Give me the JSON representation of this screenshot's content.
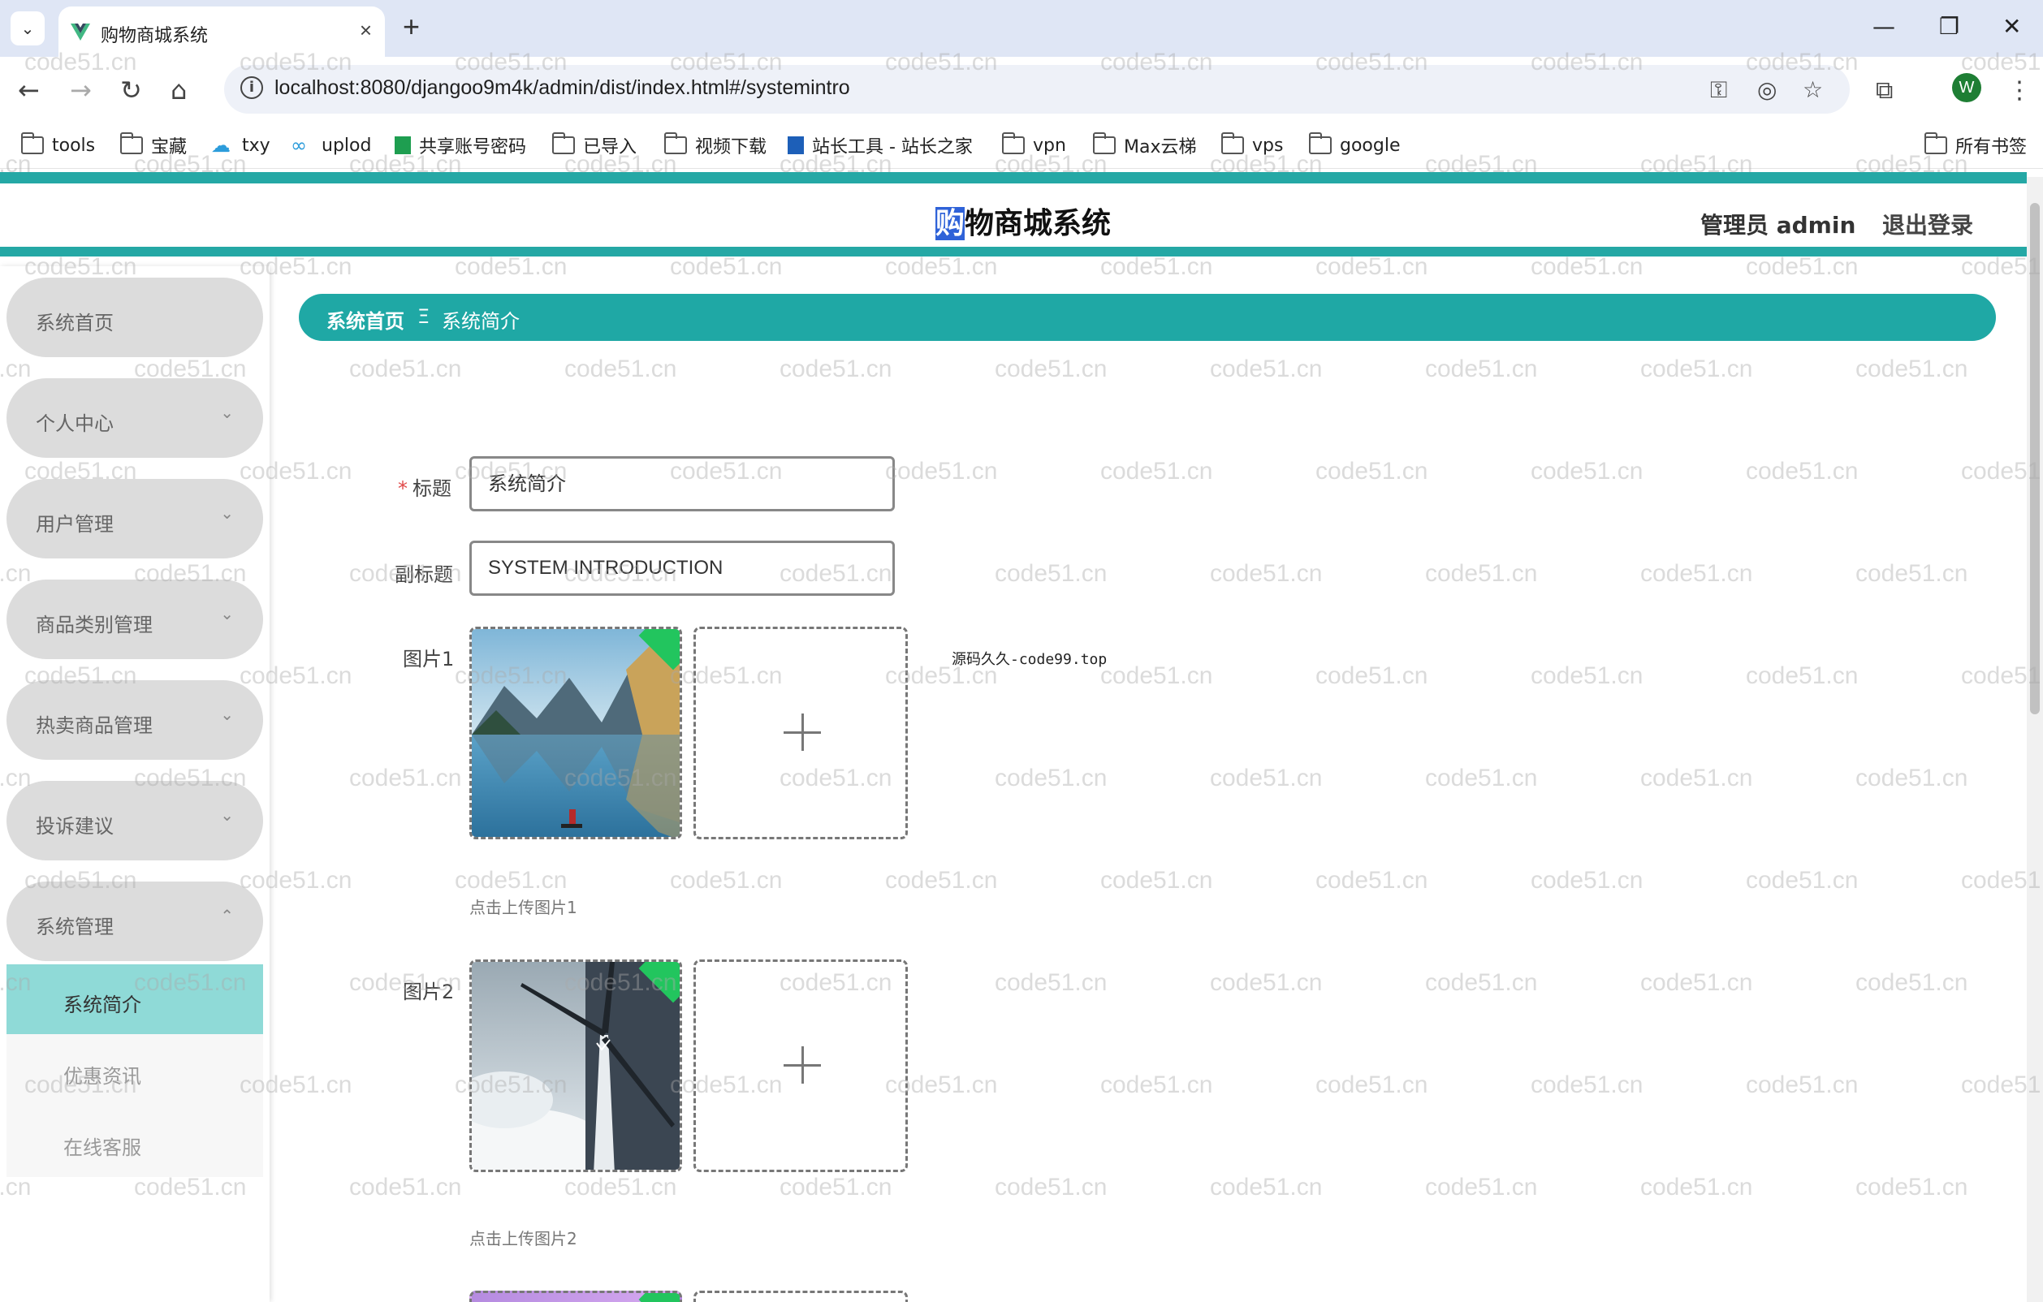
{
  "browser": {
    "tab_title": "购物商城系统",
    "url": "localhost:8080/djangoo9m4k/admin/dist/index.html#/systemintro",
    "profile_initial": "W",
    "bookmarks": [
      {
        "label": "tools",
        "icon": "folder-icon"
      },
      {
        "label": "宝藏",
        "icon": "folder-icon"
      },
      {
        "label": "txy",
        "icon": "cloud-icon"
      },
      {
        "label": "uplod",
        "icon": "link-icon"
      },
      {
        "label": "共享账号密码",
        "icon": "sheet-icon"
      },
      {
        "label": "已导入",
        "icon": "folder-icon"
      },
      {
        "label": "视频下载",
        "icon": "folder-icon"
      },
      {
        "label": "站长工具 - 站长之家",
        "icon": "site-icon"
      },
      {
        "label": "vpn",
        "icon": "folder-icon"
      },
      {
        "label": "Max云梯",
        "icon": "folder-icon"
      },
      {
        "label": "vps",
        "icon": "folder-icon"
      },
      {
        "label": "google",
        "icon": "folder-icon"
      }
    ],
    "all_bookmarks": "所有书签"
  },
  "header": {
    "title_first_char": "购",
    "title_rest": "物商城系统",
    "admin_label": "管理员 admin",
    "logout_label": "退出登录"
  },
  "sidebar": {
    "items": [
      {
        "label": "系统首页",
        "arrow": ""
      },
      {
        "label": "个人中心",
        "arrow": "⌄"
      },
      {
        "label": "用户管理",
        "arrow": "⌄"
      },
      {
        "label": "商品类别管理",
        "arrow": "⌄"
      },
      {
        "label": "热卖商品管理",
        "arrow": "⌄"
      },
      {
        "label": "投诉建议",
        "arrow": "⌄"
      },
      {
        "label": "系统管理",
        "arrow": "⌃"
      }
    ],
    "sub_items": [
      {
        "label": "系统简介",
        "active": true
      },
      {
        "label": "优惠资讯",
        "active": false
      },
      {
        "label": "在线客服",
        "active": false
      }
    ]
  },
  "breadcrumb": {
    "home": "系统首页",
    "separator": "Ξ",
    "current": "系统简介"
  },
  "form": {
    "title_label": "标题",
    "title_required_mark": "*",
    "title_value": "系统简介",
    "subtitle_label": "副标题",
    "subtitle_value": "SYSTEM INTRODUCTION",
    "image1_label": "图片1",
    "image1_hint": "点击上传图片1",
    "image2_label": "图片2",
    "image2_hint": "点击上传图片2"
  },
  "overlay_note": "源码久久-code99.top",
  "watermark_text": "code51.cn",
  "colors": {
    "accent": "#25a8a5",
    "breadcrumb_bg": "#1fa8a5",
    "active_submenu": "#8fdad7",
    "sidebar_item_bg": "#dcdcdc"
  }
}
